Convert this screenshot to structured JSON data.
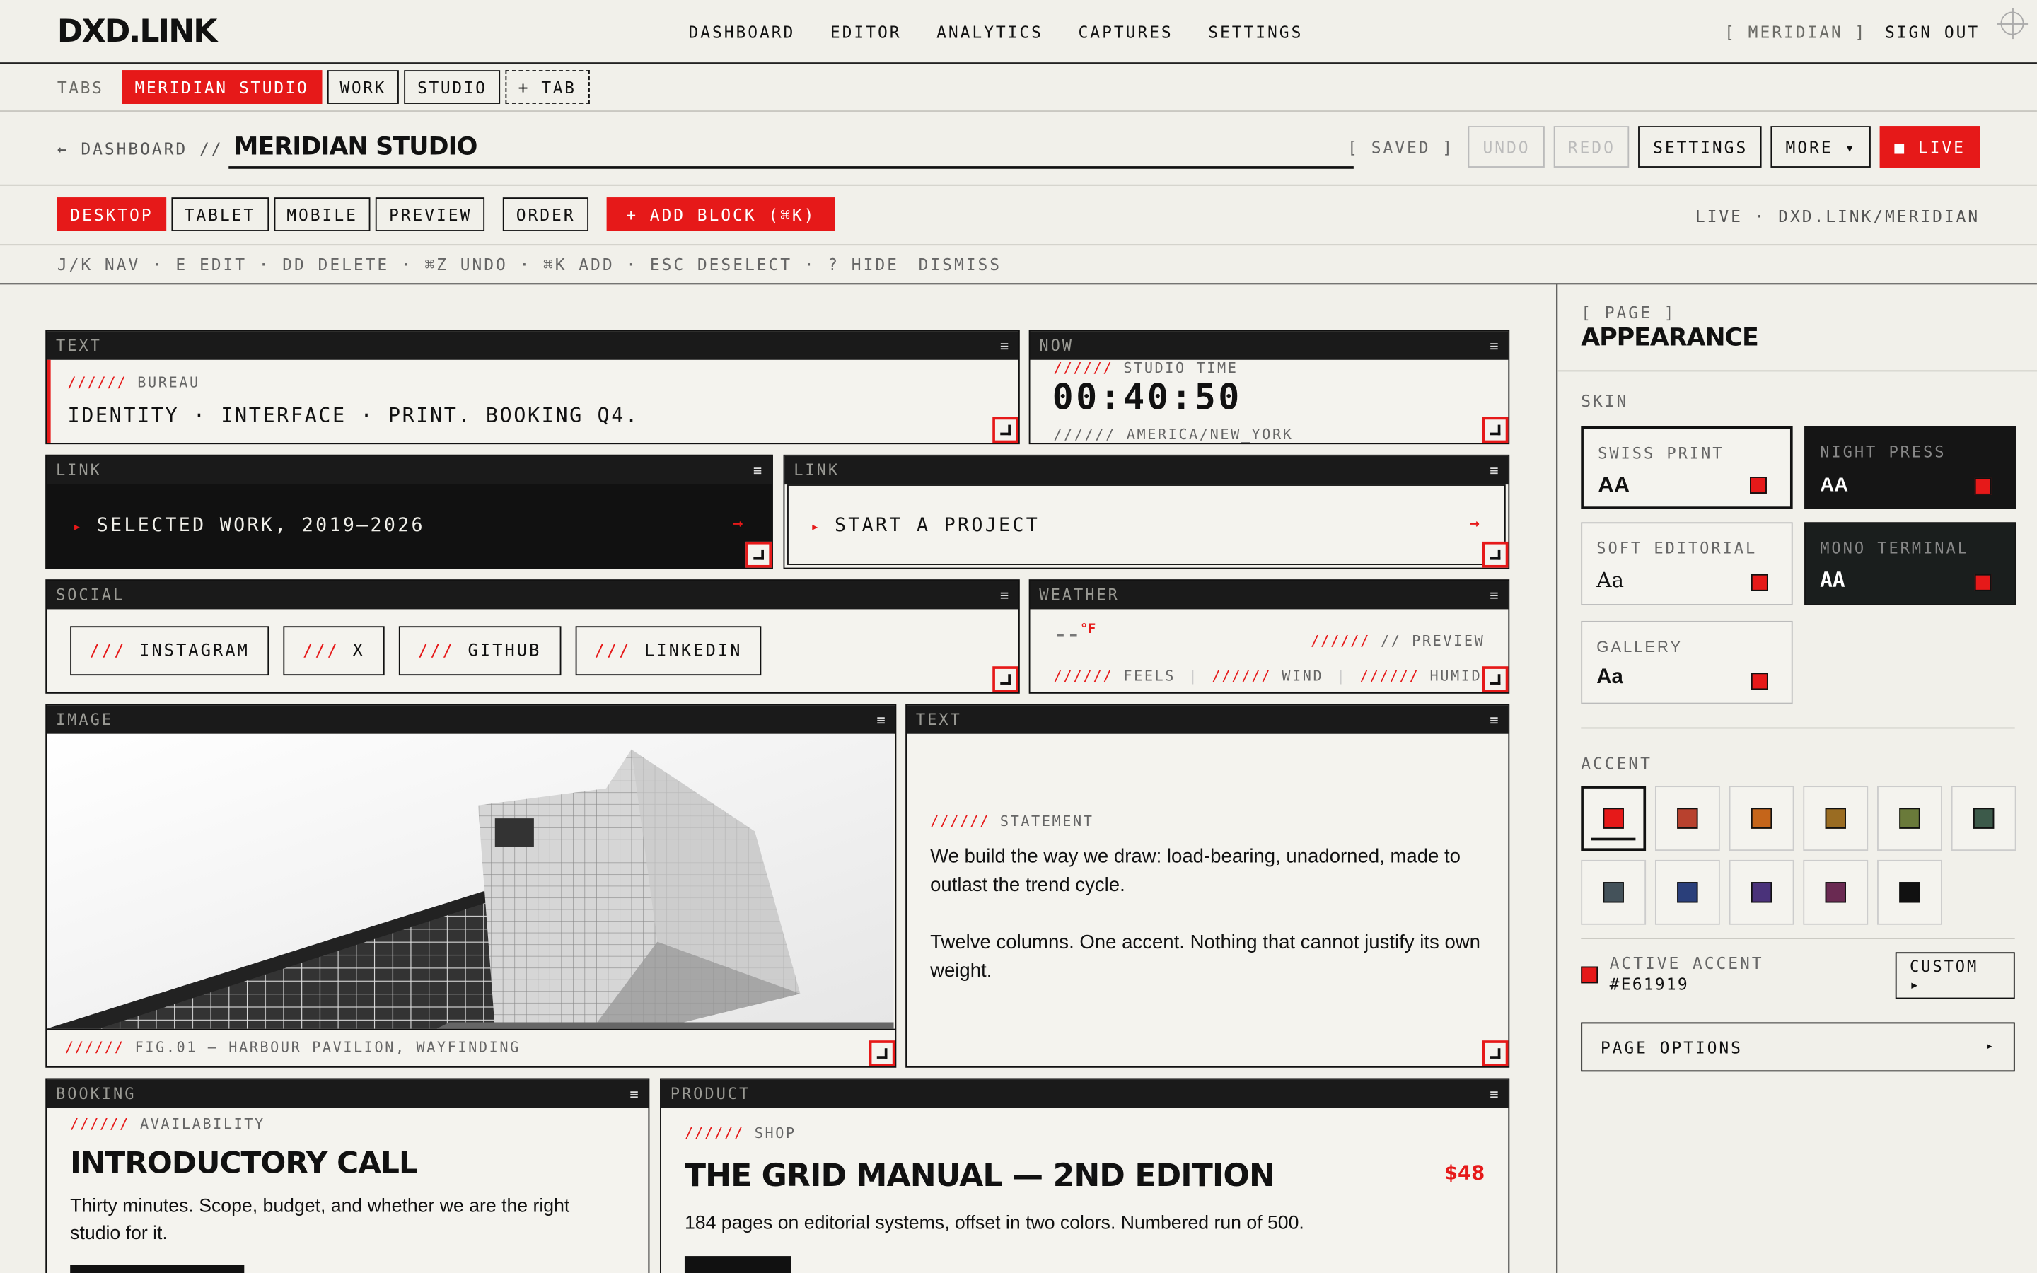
{
  "topnav": {
    "logo": "DXD.LINK",
    "links": [
      "DASHBOARD",
      "EDITOR",
      "ANALYTICS",
      "CAPTURES",
      "SETTINGS"
    ],
    "account": "[ MERIDIAN ]",
    "signout": "SIGN OUT"
  },
  "tabs": {
    "label": "TABS",
    "items": [
      "MERIDIAN STUDIO",
      "WORK",
      "STUDIO"
    ],
    "add": "+ TAB"
  },
  "titlebar": {
    "crumb": "← DASHBOARD //",
    "title": "MERIDIAN STUDIO",
    "saved": "[ SAVED ]",
    "undo": "UNDO",
    "redo": "REDO",
    "settings": "SETTINGS",
    "more": "MORE ▾",
    "live": "■ LIVE"
  },
  "devices": {
    "items": [
      "DESKTOP",
      "TABLET",
      "MOBILE",
      "PREVIEW"
    ],
    "order": "ORDER",
    "add_block": "+ ADD BLOCK (⌘K)",
    "live_url": "LIVE · DXD.LINK/MERIDIAN"
  },
  "shortcuts": {
    "text": "J/K NAV · E EDIT · DD DELETE · ⌘Z UNDO · ⌘K ADD · ESC DESELECT · ? HIDE",
    "dismiss": "DISMISS"
  },
  "blocks": {
    "text1": {
      "head": "TEXT",
      "slashes": "//////",
      "kicker": "BUREAU",
      "body": "IDENTITY · INTERFACE · PRINT. BOOKING Q4."
    },
    "now": {
      "head": "NOW",
      "slashes": "//////",
      "kicker": "STUDIO TIME",
      "time": "00:40:50",
      "tz": "AMERICA/NEW_YORK"
    },
    "link1": {
      "head": "LINK",
      "arrow": "▸",
      "label": "SELECTED WORK, 2019–2026",
      "go": "→"
    },
    "link2": {
      "head": "LINK",
      "arrow": "▸",
      "label": "START A PROJECT",
      "go": "→"
    },
    "social": {
      "head": "SOCIAL",
      "items": [
        "INSTAGRAM",
        "X",
        "GITHUB",
        "LINKEDIN"
      ],
      "prefix": "///"
    },
    "weather": {
      "head": "WEATHER",
      "temp": "--",
      "unit": "°F",
      "preview": "// PREVIEW",
      "slashes": "//////",
      "feels": "FEELS",
      "wind": "WIND",
      "humid": "HUMID"
    },
    "image": {
      "head": "IMAGE",
      "slashes": "//////",
      "caption": "FIG.01 — HARBOUR PAVILION, WAYFINDING"
    },
    "text2": {
      "head": "TEXT",
      "slashes": "//////",
      "kicker": "STATEMENT",
      "p1": "We build the way we draw: load-bearing, unadorned, made to outlast the trend cycle.",
      "p2": "Twelve columns. One accent. Nothing that cannot justify its own weight."
    },
    "booking": {
      "head": "BOOKING",
      "slashes": "//////",
      "kicker": "AVAILABILITY",
      "title": "INTRODUCTORY CALL",
      "body": "Thirty minutes. Scope, budget, and whether we are the right studio for it."
    },
    "product": {
      "head": "PRODUCT",
      "slashes": "//////",
      "kicker": "SHOP",
      "title": "THE GRID MANUAL — 2ND EDITION",
      "price": "$48",
      "body": "184 pages on editorial systems, offset in two colors. Numbered run of 500."
    },
    "menu_icon": "≡"
  },
  "panel": {
    "tag": "[ PAGE ]",
    "title": "APPEARANCE",
    "skin_label": "SKIN",
    "skins": [
      {
        "name": "SWISS PRINT",
        "aa": "AA"
      },
      {
        "name": "NIGHT PRESS",
        "aa": "AA"
      },
      {
        "name": "SOFT EDITORIAL",
        "aa": "Aa"
      },
      {
        "name": "MONO TERMINAL",
        "aa": "AA"
      },
      {
        "name": "GALLERY",
        "aa": "Aa"
      }
    ],
    "accent_label": "ACCENT",
    "accents": [
      "#e61919",
      "#b8412e",
      "#c5651a",
      "#9a6c22",
      "#6a7a3a",
      "#3c5a4a",
      "#44525a",
      "#2a3f7a",
      "#4a327a",
      "#6a2a52",
      "#111111"
    ],
    "active_label": "ACTIVE ACCENT",
    "active_value": "#E61919",
    "custom": "CUSTOM ▸",
    "page_options": "PAGE OPTIONS",
    "page_options_arrow": "▸"
  },
  "colors": {
    "accent": "#e61919",
    "bg": "#f1f0ea",
    "ink": "#111111"
  }
}
